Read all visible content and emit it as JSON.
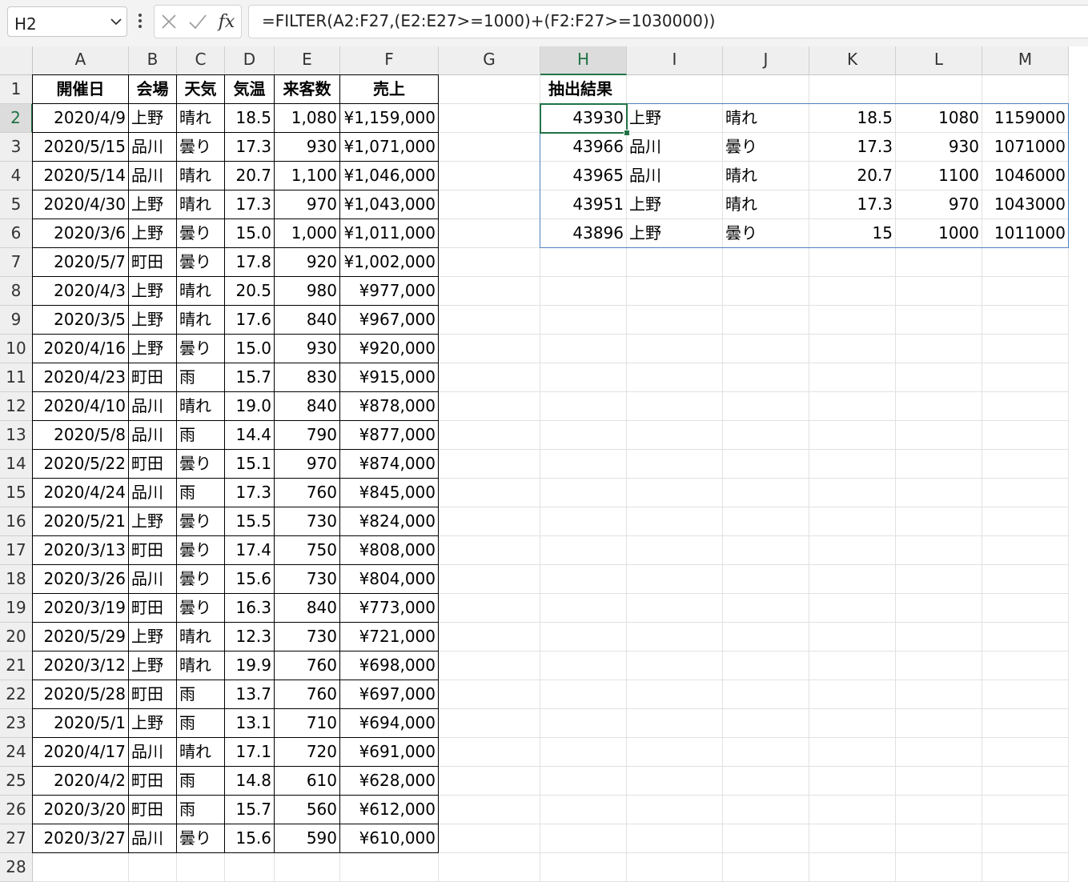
{
  "name_box": "H2",
  "formula": "=FILTER(A2:F27,(E2:E27>=1000)+(F2:F27>=1030000))",
  "icons": {
    "cancel": "close-icon",
    "enter": "check-icon",
    "function": "fx-icon",
    "more": "more-vertical-icon",
    "dropdown": "chevron-down-icon"
  },
  "columns": [
    "A",
    "B",
    "C",
    "D",
    "E",
    "F",
    "G",
    "H",
    "I",
    "J",
    "K",
    "L",
    "M"
  ],
  "row_numbers": [
    "1",
    "2",
    "3",
    "4",
    "5",
    "6",
    "7",
    "8",
    "9",
    "10",
    "11",
    "12",
    "13",
    "14",
    "15",
    "16",
    "17",
    "18",
    "19",
    "20",
    "21",
    "22",
    "23",
    "24",
    "25",
    "26",
    "27",
    "28"
  ],
  "table_headers": [
    "開催日",
    "会場",
    "天気",
    "気温",
    "来客数",
    "売上"
  ],
  "rows": [
    [
      "2020/4/9",
      "上野",
      "晴れ",
      "18.5",
      "1,080",
      "¥1,159,000"
    ],
    [
      "2020/5/15",
      "品川",
      "曇り",
      "17.3",
      "930",
      "¥1,071,000"
    ],
    [
      "2020/5/14",
      "品川",
      "晴れ",
      "20.7",
      "1,100",
      "¥1,046,000"
    ],
    [
      "2020/4/30",
      "上野",
      "晴れ",
      "17.3",
      "970",
      "¥1,043,000"
    ],
    [
      "2020/3/6",
      "上野",
      "曇り",
      "15.0",
      "1,000",
      "¥1,011,000"
    ],
    [
      "2020/5/7",
      "町田",
      "曇り",
      "17.8",
      "920",
      "¥1,002,000"
    ],
    [
      "2020/4/3",
      "上野",
      "晴れ",
      "20.5",
      "980",
      "¥977,000"
    ],
    [
      "2020/3/5",
      "上野",
      "晴れ",
      "17.6",
      "840",
      "¥967,000"
    ],
    [
      "2020/4/16",
      "上野",
      "曇り",
      "15.0",
      "930",
      "¥920,000"
    ],
    [
      "2020/4/23",
      "町田",
      "雨",
      "15.7",
      "830",
      "¥915,000"
    ],
    [
      "2020/4/10",
      "品川",
      "晴れ",
      "19.0",
      "840",
      "¥878,000"
    ],
    [
      "2020/5/8",
      "品川",
      "雨",
      "14.4",
      "790",
      "¥877,000"
    ],
    [
      "2020/5/22",
      "町田",
      "曇り",
      "15.1",
      "970",
      "¥874,000"
    ],
    [
      "2020/4/24",
      "品川",
      "雨",
      "17.3",
      "760",
      "¥845,000"
    ],
    [
      "2020/5/21",
      "上野",
      "曇り",
      "15.5",
      "730",
      "¥824,000"
    ],
    [
      "2020/3/13",
      "町田",
      "曇り",
      "17.4",
      "750",
      "¥808,000"
    ],
    [
      "2020/3/26",
      "品川",
      "曇り",
      "15.6",
      "730",
      "¥804,000"
    ],
    [
      "2020/3/19",
      "町田",
      "曇り",
      "16.3",
      "840",
      "¥773,000"
    ],
    [
      "2020/5/29",
      "上野",
      "晴れ",
      "12.3",
      "730",
      "¥721,000"
    ],
    [
      "2020/3/12",
      "上野",
      "晴れ",
      "19.9",
      "760",
      "¥698,000"
    ],
    [
      "2020/5/28",
      "町田",
      "雨",
      "13.7",
      "760",
      "¥697,000"
    ],
    [
      "2020/5/1",
      "上野",
      "雨",
      "13.1",
      "710",
      "¥694,000"
    ],
    [
      "2020/4/17",
      "品川",
      "晴れ",
      "17.1",
      "720",
      "¥691,000"
    ],
    [
      "2020/4/2",
      "町田",
      "雨",
      "14.8",
      "610",
      "¥628,000"
    ],
    [
      "2020/3/20",
      "町田",
      "雨",
      "15.7",
      "560",
      "¥612,000"
    ],
    [
      "2020/3/27",
      "品川",
      "曇り",
      "15.6",
      "590",
      "¥610,000"
    ]
  ],
  "result_header": "抽出結果",
  "results": [
    [
      "43930",
      "上野",
      "晴れ",
      "18.5",
      "1080",
      "1159000"
    ],
    [
      "43966",
      "品川",
      "曇り",
      "17.3",
      "930",
      "1071000"
    ],
    [
      "43965",
      "品川",
      "晴れ",
      "20.7",
      "1100",
      "1046000"
    ],
    [
      "43951",
      "上野",
      "晴れ",
      "17.3",
      "970",
      "1043000"
    ],
    [
      "43896",
      "上野",
      "曇り",
      "15",
      "1000",
      "1011000"
    ]
  ],
  "active_cell": "H2",
  "colors": {
    "accent": "#217346",
    "spill_border": "#4f81bd",
    "header_bg": "#efefef",
    "gridline": "#e1e1e1"
  }
}
